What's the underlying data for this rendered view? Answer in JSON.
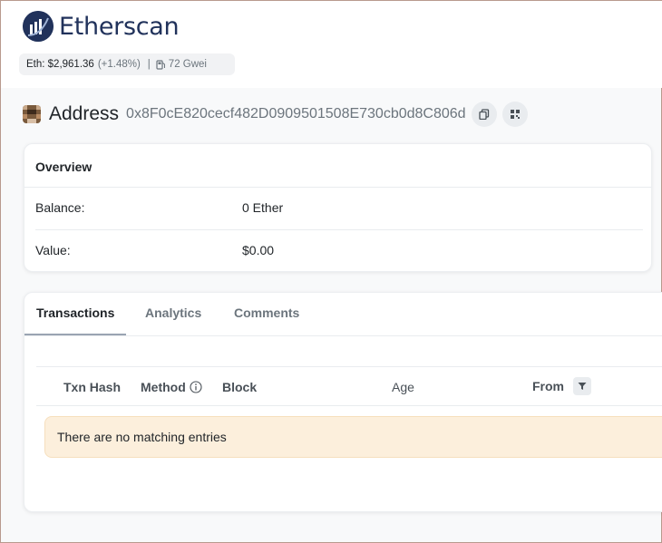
{
  "brand": {
    "name": "Etherscan",
    "icon": "etherscan-logo-icon",
    "color": "#21325b"
  },
  "price_bar": {
    "eth_price": "Eth: $2,961.36",
    "eth_change": "(+1.48%)",
    "separator": "|",
    "gas_icon": "gas-pump-icon",
    "gas": "72 Gwei"
  },
  "address": {
    "title": "Address",
    "hash": "0x8F0cE820cecf482D0909501508E730cb0d8C806d",
    "copy_icon": "copy-icon",
    "qr_icon": "qr-code-icon"
  },
  "overview": {
    "title": "Overview",
    "rows": [
      {
        "label": "Balance:",
        "value": "0 Ether"
      },
      {
        "label": "Value:",
        "value": "$0.00"
      }
    ]
  },
  "tabs": [
    {
      "label": "Transactions",
      "active": true
    },
    {
      "label": "Analytics",
      "active": false
    },
    {
      "label": "Comments",
      "active": false
    }
  ],
  "table": {
    "columns": [
      "Txn Hash",
      "Method",
      "Block",
      "Age",
      "From"
    ],
    "empty_message": "There are no matching entries"
  },
  "colors": {
    "alert_bg": "#fcefdc",
    "accent": "#21325b"
  }
}
